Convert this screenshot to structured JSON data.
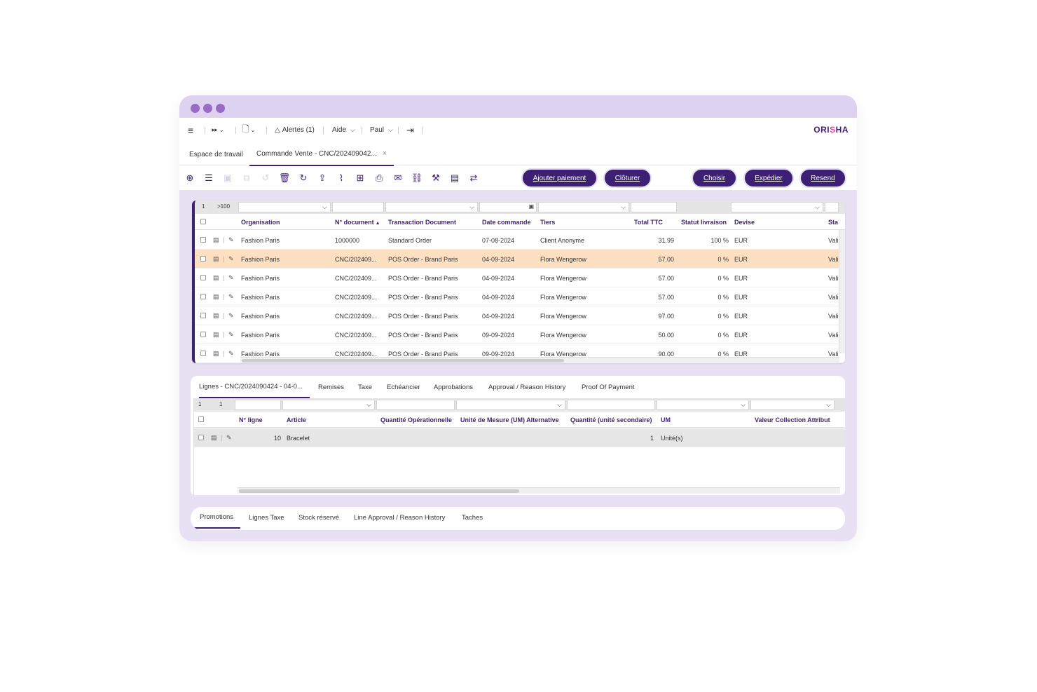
{
  "brand": {
    "name_prefix": "ORI",
    "name_accent": "S",
    "name_suffix": "HA"
  },
  "topbar": {
    "alerts_label": "Alertes (1)",
    "help_label": "Aide",
    "user_label": "Paul"
  },
  "tabs": [
    {
      "label": "Espace de travail"
    },
    {
      "label": "Commande Vente - CNC/202409042..."
    }
  ],
  "actions": {
    "add_payment": "Ajouter paiement",
    "close": "Clôturer",
    "choose": "Choisir",
    "ship": "Expédier",
    "resend": "Resend"
  },
  "grid": {
    "page": "1",
    "total": ">100",
    "headers": {
      "organisation": "Organisation",
      "document_no": "N° document",
      "transaction_document": "Transaction Document",
      "date": "Date commande",
      "partner": "Tiers",
      "total": "Total TTC",
      "delivery_status": "Statut livraison",
      "currency": "Devise",
      "status": "Sta"
    },
    "rows": [
      {
        "org": "Fashion Paris",
        "doc": "1000000",
        "type": "Standard Order",
        "date": "07-08-2024",
        "partner": "Client Anonyme",
        "total": "31.99",
        "delivery": "100 %",
        "currency": "EUR",
        "status": "Vali"
      },
      {
        "org": "Fashion Paris",
        "doc": "CNC/202409...",
        "type": "POS Order - Brand Paris",
        "date": "04-09-2024",
        "partner": "Flora Wengerow",
        "total": "57.00",
        "delivery": "0 %",
        "currency": "EUR",
        "status": "Vali"
      },
      {
        "org": "Fashion Paris",
        "doc": "CNC/202409...",
        "type": "POS Order - Brand Paris",
        "date": "04-09-2024",
        "partner": "Flora Wengerow",
        "total": "57.00",
        "delivery": "0 %",
        "currency": "EUR",
        "status": "Vali"
      },
      {
        "org": "Fashion Paris",
        "doc": "CNC/202409...",
        "type": "POS Order - Brand Paris",
        "date": "04-09-2024",
        "partner": "Flora Wengerow",
        "total": "57.00",
        "delivery": "0 %",
        "currency": "EUR",
        "status": "Vali"
      },
      {
        "org": "Fashion Paris",
        "doc": "CNC/202409...",
        "type": "POS Order - Brand Paris",
        "date": "04-09-2024",
        "partner": "Flora Wengerow",
        "total": "97.00",
        "delivery": "0 %",
        "currency": "EUR",
        "status": "Vali"
      },
      {
        "org": "Fashion Paris",
        "doc": "CNC/202409...",
        "type": "POS Order - Brand Paris",
        "date": "09-09-2024",
        "partner": "Flora Wengerow",
        "total": "50.00",
        "delivery": "0 %",
        "currency": "EUR",
        "status": "Vali"
      },
      {
        "org": "Fashion Paris",
        "doc": "CNC/202409...",
        "type": "POS Order - Brand Paris",
        "date": "09-09-2024",
        "partner": "Flora Wengerow",
        "total": "90.00",
        "delivery": "0 %",
        "currency": "EUR",
        "status": "Vali"
      }
    ]
  },
  "lines": {
    "tabs": [
      "Lignes - CNC/2024090424 - 04-0...",
      "Remises",
      "Taxe",
      "Echéancier",
      "Approbations",
      "Approval / Reason History",
      "Proof Of Payment"
    ],
    "page": "1",
    "total": "1",
    "headers": {
      "line_no": "N° ligne",
      "article": "Article",
      "operational_qty": "Quantité Opérationnelle",
      "alt_uom": "Unité de Mesure (UM) Alternative",
      "secondary_qty": "Quantité (unité secondaire)",
      "uom": "UM",
      "collection_attr": "Valeur Collection Attribut"
    },
    "rows": [
      {
        "line_no": "10",
        "article": "Bracelet",
        "secondary_qty": "1",
        "uom": "Unité(s)"
      }
    ]
  },
  "bottom_tabs": [
    "Promotions",
    "Lignes Taxe",
    "Stock réservé",
    "Line Approval / Reason History",
    "Taches"
  ]
}
